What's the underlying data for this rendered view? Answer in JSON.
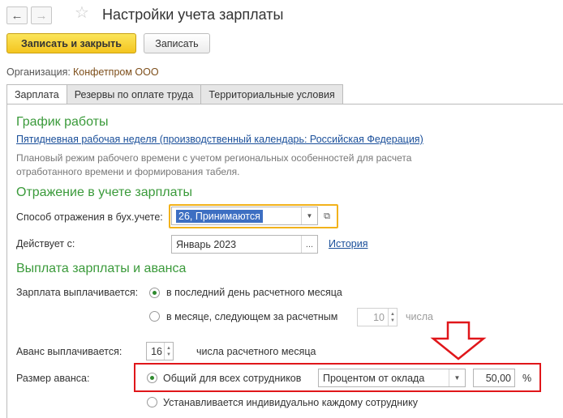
{
  "toolbar": {
    "back_icon": "arrow-left-icon",
    "forward_icon": "arrow-right-icon",
    "favorite_icon": "star-icon",
    "title": "Настройки учета зарплаты",
    "save_close_label": "Записать и закрыть",
    "save_label": "Записать"
  },
  "organization": {
    "label": "Организация:",
    "value": "Конфетпром ООО"
  },
  "tabs": [
    {
      "label": "Зарплата",
      "active": true
    },
    {
      "label": "Резервы по оплате труда",
      "active": false
    },
    {
      "label": "Территориальные условия",
      "active": false
    }
  ],
  "work_schedule": {
    "heading": "График работы",
    "link": "Пятидневная рабочая неделя (производственный календарь: Российская Федерация)",
    "note_line1": "Плановый режим рабочего времени с учетом региональных особенностей для расчета",
    "note_line2": "отработанного времени и формирования табеля."
  },
  "accounting": {
    "heading": "Отражение в учете зарплаты",
    "method_label": "Способ отражения в бух.учете:",
    "method_value": "26, Принимаются",
    "effective_label": "Действует с:",
    "effective_value": "Январь 2023",
    "history_link": "История"
  },
  "payment": {
    "heading": "Выплата зарплаты и аванса",
    "salary_label": "Зарплата выплачивается:",
    "salary_option1": "в последний день расчетного месяца",
    "salary_option2": "в месяце, следующем за расчетным",
    "salary_day_value": "10",
    "salary_day_suffix": "числа",
    "advance_label": "Аванс выплачивается:",
    "advance_day_value": "16",
    "advance_day_suffix": "числа расчетного месяца",
    "advance_size_label": "Размер аванса:",
    "advance_option1": "Общий для всех сотрудников",
    "advance_method_value": "Процентом от оклада",
    "advance_percent_value": "50,00",
    "percent_sign": "%",
    "advance_option2": "Устанавливается индивидуально каждому сотруднику"
  },
  "colors": {
    "section_heading": "#3a9a3a",
    "link": "#1a4f9a",
    "primary_button": "#f4c51f",
    "focus_frame": "#f2b21b",
    "annotation": "#e0161a"
  }
}
